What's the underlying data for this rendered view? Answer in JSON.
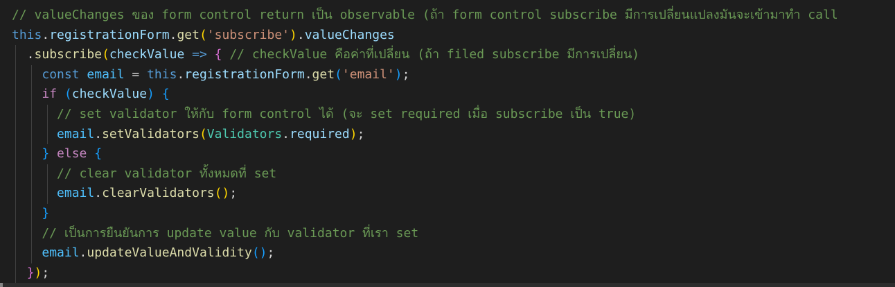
{
  "editor": {
    "language": "typescript",
    "theme": "dark",
    "lines": [
      [
        {
          "t": "// valueChanges ของ form control return เป็น observable (ถ้า form control subscribe มีการเปลี่ยนแปลงมันจะเข้ามาทำ call",
          "c": "c"
        }
      ],
      [
        {
          "t": "this",
          "c": "k"
        },
        {
          "t": ".",
          "c": "p"
        },
        {
          "t": "registrationForm",
          "c": "v"
        },
        {
          "t": ".",
          "c": "p"
        },
        {
          "t": "get",
          "c": "f"
        },
        {
          "t": "(",
          "c": "br1"
        },
        {
          "t": "'subscribe'",
          "c": "s"
        },
        {
          "t": ")",
          "c": "br1"
        },
        {
          "t": ".",
          "c": "p"
        },
        {
          "t": "valueChanges",
          "c": "v"
        }
      ],
      [
        {
          "t": "  .",
          "c": "p"
        },
        {
          "t": "subscribe",
          "c": "f"
        },
        {
          "t": "(",
          "c": "br1"
        },
        {
          "t": "checkValue",
          "c": "v"
        },
        {
          "t": " ",
          "c": "p"
        },
        {
          "t": "=>",
          "c": "k"
        },
        {
          "t": " ",
          "c": "p"
        },
        {
          "t": "{",
          "c": "br2"
        },
        {
          "t": " // checkValue คือค่าที่เปลี่ยน (ถ้า filed subscribe มีการเปลี่ยน)",
          "c": "c"
        }
      ],
      [
        {
          "t": "    ",
          "c": "p"
        },
        {
          "t": "const",
          "c": "k"
        },
        {
          "t": " ",
          "c": "p"
        },
        {
          "t": "email",
          "c": "cv"
        },
        {
          "t": " = ",
          "c": "p"
        },
        {
          "t": "this",
          "c": "k"
        },
        {
          "t": ".",
          "c": "p"
        },
        {
          "t": "registrationForm",
          "c": "v"
        },
        {
          "t": ".",
          "c": "p"
        },
        {
          "t": "get",
          "c": "f"
        },
        {
          "t": "(",
          "c": "br3"
        },
        {
          "t": "'email'",
          "c": "s"
        },
        {
          "t": ")",
          "c": "br3"
        },
        {
          "t": ";",
          "c": "p"
        }
      ],
      [
        {
          "t": "    ",
          "c": "p"
        },
        {
          "t": "if",
          "c": "ctl"
        },
        {
          "t": " ",
          "c": "p"
        },
        {
          "t": "(",
          "c": "br3"
        },
        {
          "t": "checkValue",
          "c": "v"
        },
        {
          "t": ")",
          "c": "br3"
        },
        {
          "t": " ",
          "c": "p"
        },
        {
          "t": "{",
          "c": "br3"
        }
      ],
      [
        {
          "t": "      // set validator ให้กับ form control ได้ (จะ set required เมื่อ subscribe เป็น true)",
          "c": "c"
        }
      ],
      [
        {
          "t": "      ",
          "c": "p"
        },
        {
          "t": "email",
          "c": "cv"
        },
        {
          "t": ".",
          "c": "p"
        },
        {
          "t": "setValidators",
          "c": "f"
        },
        {
          "t": "(",
          "c": "br1"
        },
        {
          "t": "Validators",
          "c": "t"
        },
        {
          "t": ".",
          "c": "p"
        },
        {
          "t": "required",
          "c": "v"
        },
        {
          "t": ")",
          "c": "br1"
        },
        {
          "t": ";",
          "c": "p"
        }
      ],
      [
        {
          "t": "    ",
          "c": "p"
        },
        {
          "t": "}",
          "c": "br3"
        },
        {
          "t": " ",
          "c": "p"
        },
        {
          "t": "else",
          "c": "ctl"
        },
        {
          "t": " ",
          "c": "p"
        },
        {
          "t": "{",
          "c": "br3"
        }
      ],
      [
        {
          "t": "      // clear validator ทั้งหมดที่ set",
          "c": "c"
        }
      ],
      [
        {
          "t": "      ",
          "c": "p"
        },
        {
          "t": "email",
          "c": "cv"
        },
        {
          "t": ".",
          "c": "p"
        },
        {
          "t": "clearValidators",
          "c": "f"
        },
        {
          "t": "(",
          "c": "br1"
        },
        {
          "t": ")",
          "c": "br1"
        },
        {
          "t": ";",
          "c": "p"
        }
      ],
      [
        {
          "t": "    ",
          "c": "p"
        },
        {
          "t": "}",
          "c": "br3"
        }
      ],
      [
        {
          "t": "    // เป็นการยืนยันการ update value กับ validator ที่เรา set",
          "c": "c"
        }
      ],
      [
        {
          "t": "    ",
          "c": "p"
        },
        {
          "t": "email",
          "c": "cv"
        },
        {
          "t": ".",
          "c": "p"
        },
        {
          "t": "updateValueAndValidity",
          "c": "f"
        },
        {
          "t": "(",
          "c": "br3"
        },
        {
          "t": ")",
          "c": "br3"
        },
        {
          "t": ";",
          "c": "p"
        }
      ],
      [
        {
          "t": "  ",
          "c": "p"
        },
        {
          "t": "}",
          "c": "br2"
        },
        {
          "t": ")",
          "c": "br1"
        },
        {
          "t": ";",
          "c": "p"
        }
      ]
    ],
    "indent_guide_levels": [
      0,
      0,
      1,
      2,
      2,
      3,
      3,
      2,
      3,
      3,
      2,
      2,
      2,
      1
    ]
  },
  "colors": {
    "background": "#1e1e1e",
    "comment": "#6a9955",
    "keyword": "#569cd6",
    "control": "#c586c0",
    "variable": "#9cdcfe",
    "constant": "#4fc1ff",
    "function": "#dcdcaa",
    "string": "#ce9178",
    "type": "#4ec9b0",
    "indent_guide": "#404040"
  }
}
